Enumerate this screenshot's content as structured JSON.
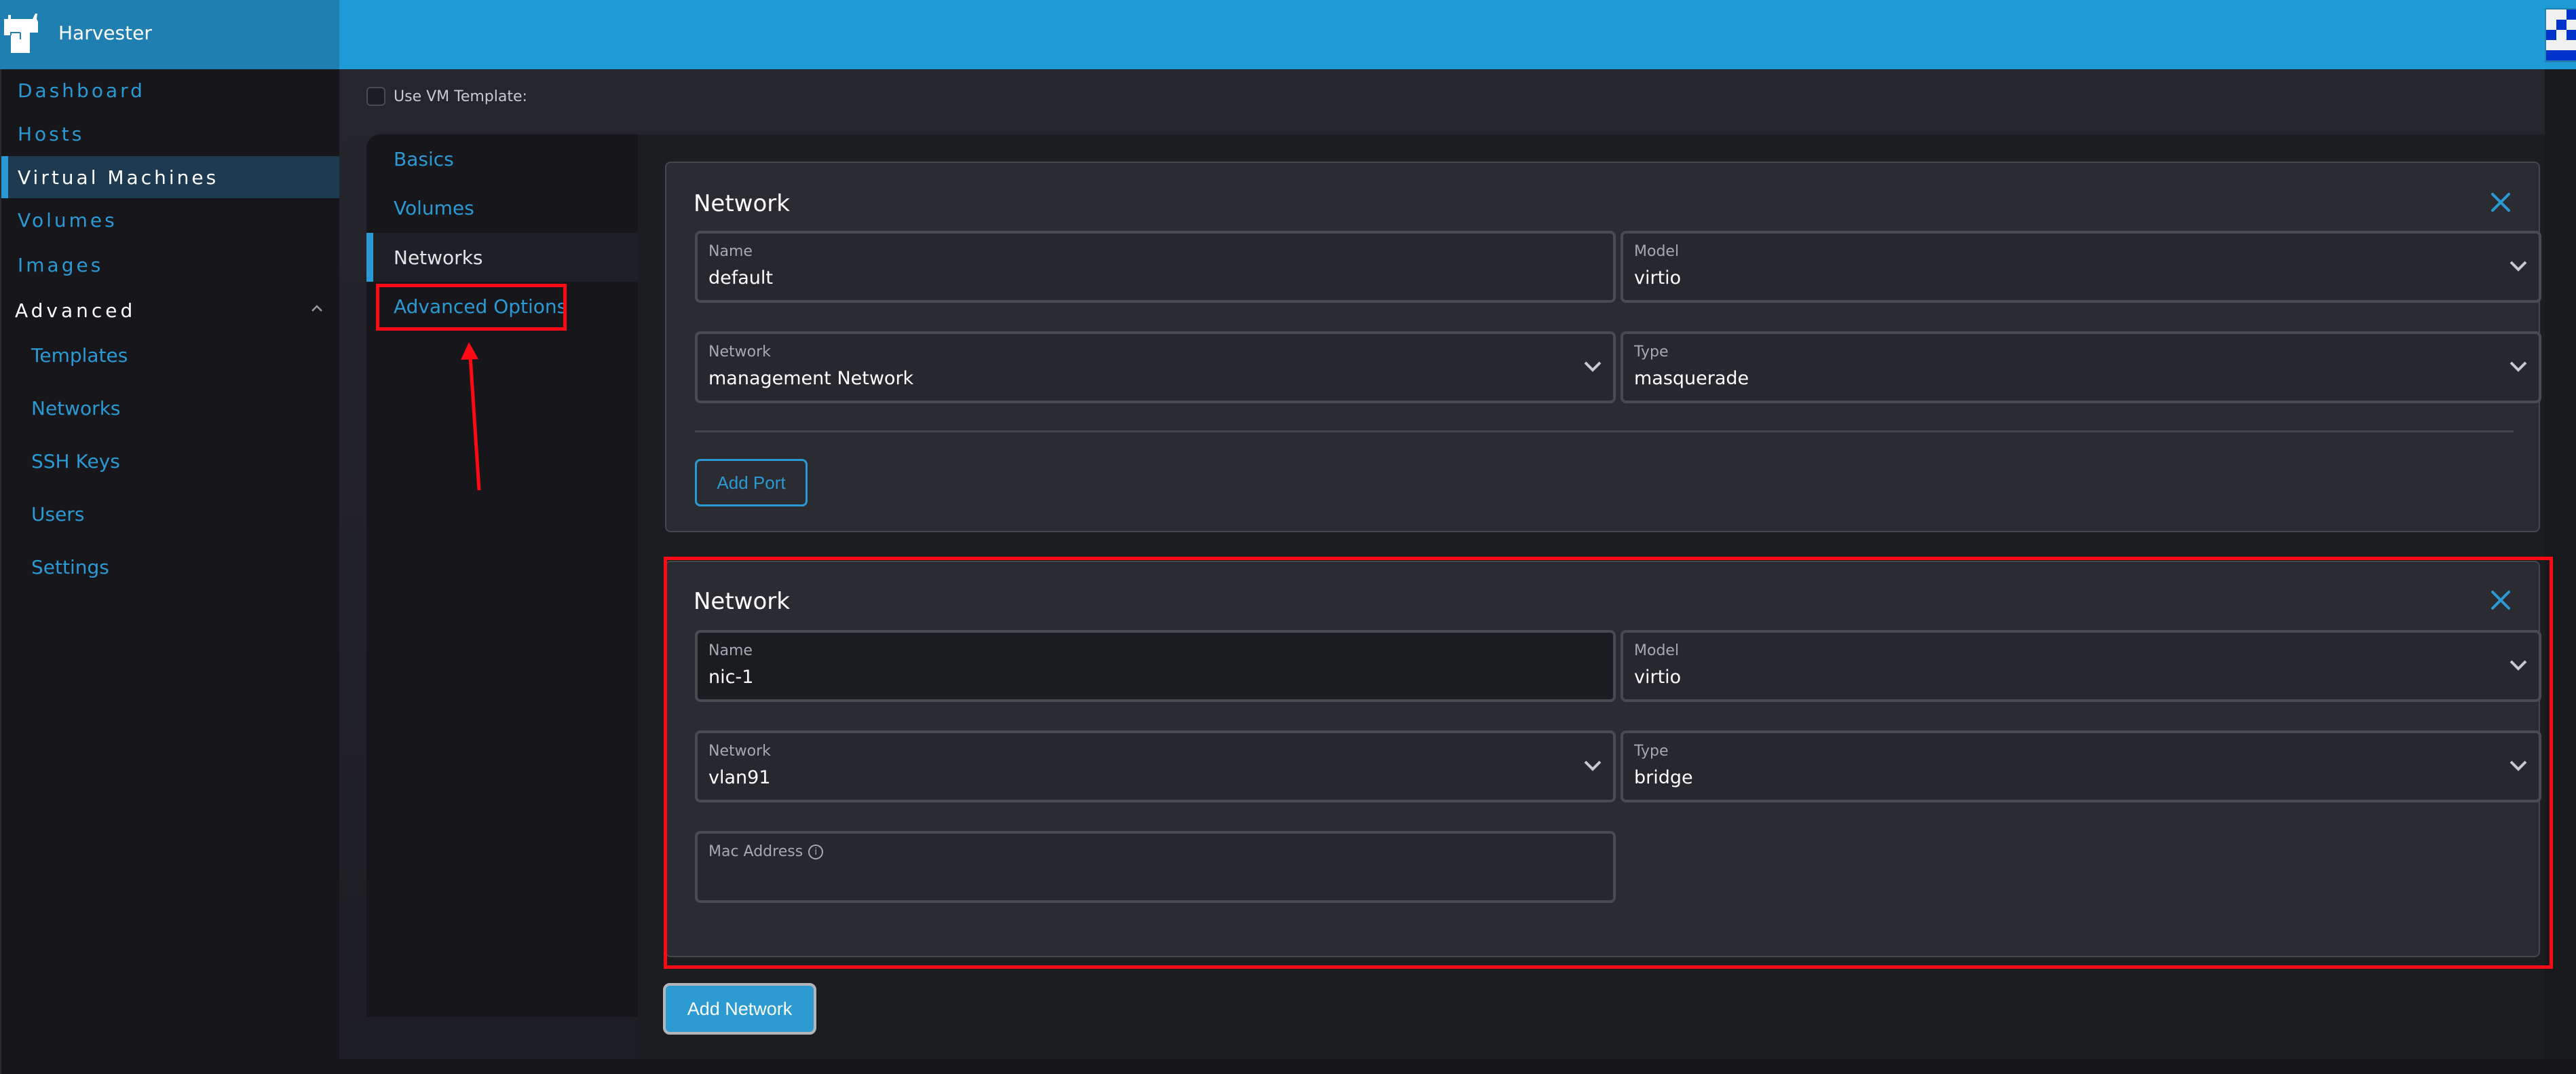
{
  "app": {
    "name": "Harvester",
    "logo_icon": "harvester-bull-logo",
    "avatar_icon": "identicon-avatar",
    "colors": {
      "accent": "#2b9ad4",
      "header": "#1e9bd7",
      "annotation": "#ff0a14"
    }
  },
  "sidebar": {
    "items": [
      {
        "label": "Dashboard",
        "active": false
      },
      {
        "label": "Hosts",
        "active": false
      },
      {
        "label": "Virtual Machines",
        "active": true
      },
      {
        "label": "Volumes",
        "active": false
      },
      {
        "label": "Images",
        "active": false
      }
    ],
    "group": {
      "label": "Advanced",
      "expanded": true,
      "icon": "chevron-up-icon",
      "items": [
        {
          "label": "Templates"
        },
        {
          "label": "Networks"
        },
        {
          "label": "SSH Keys"
        },
        {
          "label": "Users"
        },
        {
          "label": "Settings"
        }
      ]
    }
  },
  "form": {
    "use_template_label": "Use VM Template:",
    "use_template_checked": false,
    "tabs": [
      {
        "label": "Basics",
        "active": false
      },
      {
        "label": "Volumes",
        "active": false
      },
      {
        "label": "Networks",
        "active": true
      },
      {
        "label": "Advanced Options",
        "active": false
      }
    ],
    "networks": [
      {
        "title": "Network",
        "name": {
          "label": "Name",
          "value": "default"
        },
        "model": {
          "label": "Model",
          "value": "virtio"
        },
        "network": {
          "label": "Network",
          "value": "management Network"
        },
        "type": {
          "label": "Type",
          "value": "masquerade"
        },
        "add_port_label": "Add Port"
      },
      {
        "title": "Network",
        "name": {
          "label": "Name",
          "value": "nic-1"
        },
        "model": {
          "label": "Model",
          "value": "virtio"
        },
        "network": {
          "label": "Network",
          "value": "vlan91"
        },
        "type": {
          "label": "Type",
          "value": "bridge"
        },
        "mac": {
          "label": "Mac Address",
          "value": "",
          "info_icon": "info-icon"
        }
      }
    ],
    "add_network_label": "Add Network"
  }
}
